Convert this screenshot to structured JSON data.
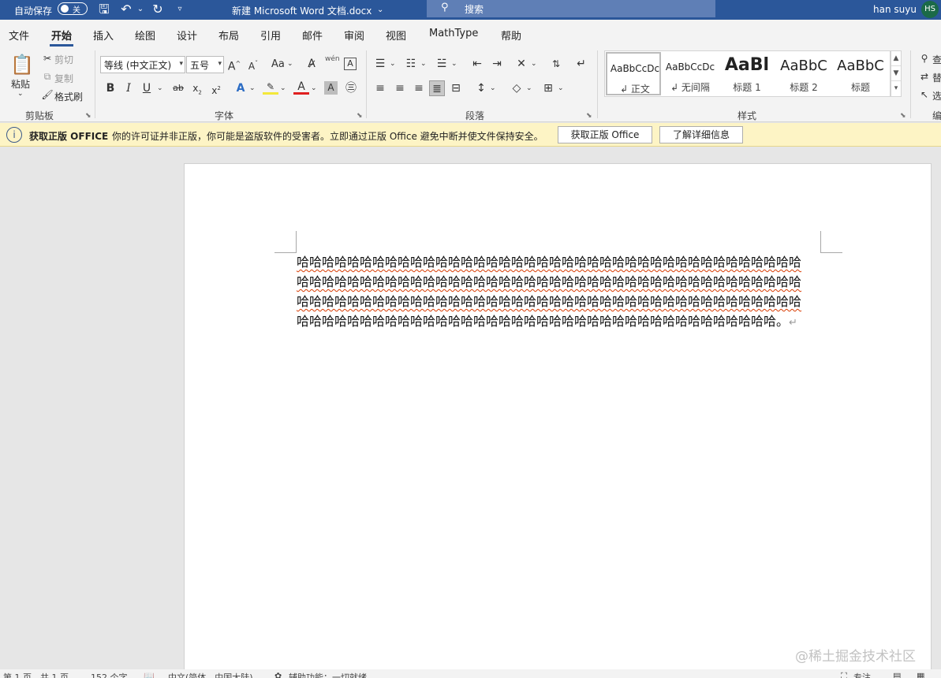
{
  "titlebar": {
    "autosave_label": "自动保存",
    "autosave_state": "关",
    "doc_title": "新建 Microsoft Word 文档.docx",
    "search_placeholder": "搜索",
    "user_name": "han suyu",
    "user_initials": "HS"
  },
  "menu": {
    "file": "文件",
    "home": "开始",
    "insert": "插入",
    "draw": "绘图",
    "design": "设计",
    "layout": "布局",
    "references": "引用",
    "mailings": "邮件",
    "review": "审阅",
    "view": "视图",
    "mathtype": "MathType",
    "help": "帮助"
  },
  "ribbon": {
    "clipboard": {
      "paste": "粘贴",
      "cut": "剪切",
      "copy": "复制",
      "format_painter": "格式刷",
      "label": "剪贴板"
    },
    "font": {
      "font_name": "等线 (中文正文)",
      "font_size": "五号",
      "change_case": "Aa",
      "label": "字体",
      "phonetic": "wén"
    },
    "paragraph": {
      "label": "段落"
    },
    "styles": {
      "label": "样式",
      "items": [
        {
          "preview": "AaBbCcDc",
          "name": "↲ 正文"
        },
        {
          "preview": "AaBbCcDc",
          "name": "↲ 无间隔"
        },
        {
          "preview": "AaBl",
          "name": "标题 1"
        },
        {
          "preview": "AaBbC",
          "name": "标题 2"
        },
        {
          "preview": "AaBbC",
          "name": "标题"
        }
      ]
    },
    "editing": {
      "find": "查",
      "replace": "替",
      "select": "选",
      "label": "编"
    }
  },
  "infobar": {
    "title": "获取正版 OFFICE",
    "message": "你的许可证并非正版，你可能是盗版软件的受害者。立即通过正版 Office 避免中断并使文件保持安全。",
    "btn_get": "获取正版 Office",
    "btn_learn": "了解详细信息"
  },
  "document": {
    "lines": [
      "哈哈哈哈哈哈哈哈哈哈哈哈哈哈哈哈哈哈哈哈哈哈哈哈哈哈哈哈哈哈哈哈哈哈哈哈哈哈哈哈",
      "哈哈哈哈哈哈哈哈哈哈哈哈哈哈哈哈哈哈哈哈哈哈哈哈哈哈哈哈哈哈哈哈哈哈哈哈哈哈哈哈",
      "哈哈哈哈哈哈哈哈哈哈哈哈哈哈哈哈哈哈哈哈哈哈哈哈哈哈哈哈哈哈哈哈哈哈哈哈哈哈哈哈",
      "哈哈哈哈哈哈哈哈哈哈哈哈哈哈哈哈哈哈哈哈哈哈哈哈哈哈哈哈哈哈哈哈哈哈哈哈哈哈。"
    ],
    "return_mark": "↵"
  },
  "statusbar": {
    "page": "第 1 页，共 1 页",
    "words": "152 个字",
    "language": "中文(简体，中国大陆)",
    "accessibility": "辅助功能：一切就绪",
    "focus": "专注"
  },
  "watermark": "@稀土掘金技术社区"
}
